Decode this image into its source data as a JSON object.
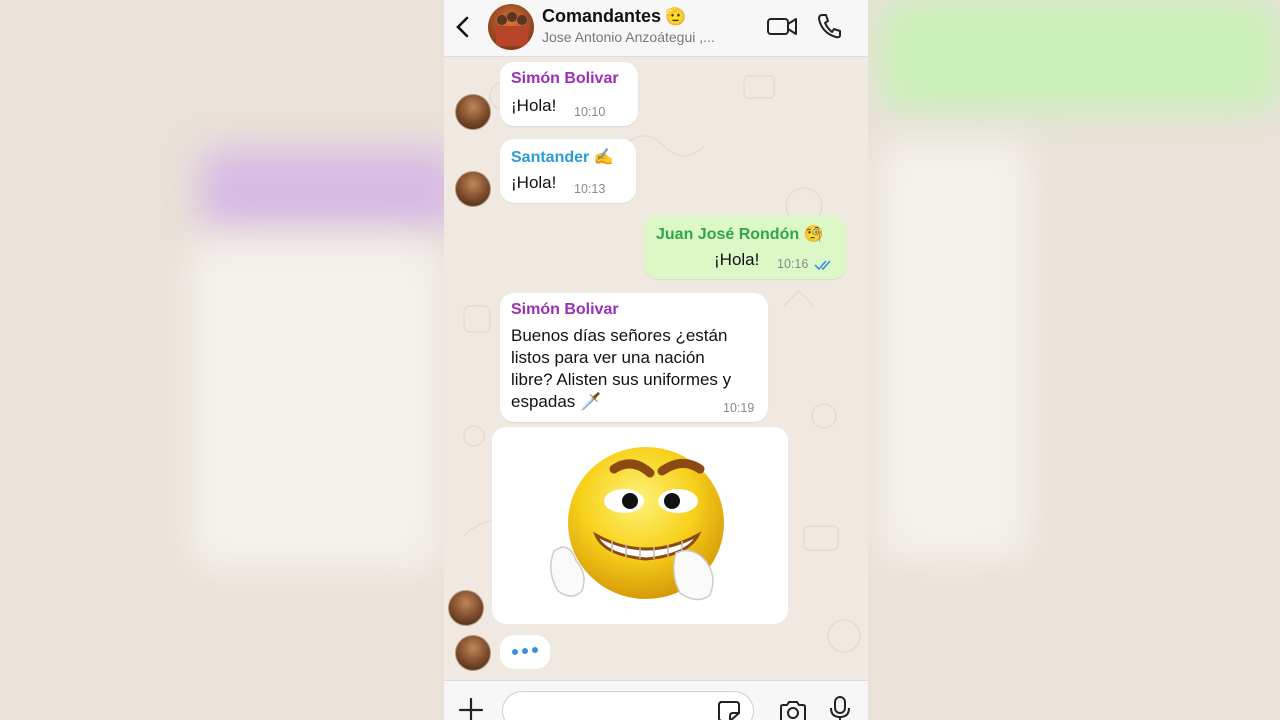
{
  "header": {
    "title": "Comandantes",
    "title_emoji": "🫡",
    "members": "Jose Antonio Anzoátegui ,..."
  },
  "messages": [
    {
      "sender": "Simón Bolivar",
      "sender_color": "#9b2fb5",
      "text": "¡Hola!",
      "time": "10:10",
      "direction": "in"
    },
    {
      "sender": "Santander ✍️",
      "sender_color": "#2b9bd6",
      "text": "¡Hola!",
      "time": "10:13",
      "direction": "in"
    },
    {
      "sender": "Juan José Rondón 🧐",
      "sender_color": "#2fa64a",
      "text": "¡Hola!",
      "time": "10:16",
      "direction": "out",
      "status": "read"
    },
    {
      "sender": "Simón Bolivar",
      "sender_color": "#9b2fb5",
      "text_lines": [
        "Buenos días señores ¿están",
        "listos para ver una nación",
        "libre? Alisten sus uniformes y",
        "espadas 🗡️"
      ],
      "time": "10:19",
      "direction": "in"
    }
  ],
  "sticker": {
    "icon": "angry-grimace-emoji-sticker"
  },
  "typing": {
    "icon": "typing-dots-icon"
  },
  "composer": {
    "placeholder": ""
  },
  "colors": {
    "outgoing_bubble": "#dcf8c6",
    "incoming_bubble": "#ffffff",
    "read_ticks": "#3a8fd8"
  }
}
